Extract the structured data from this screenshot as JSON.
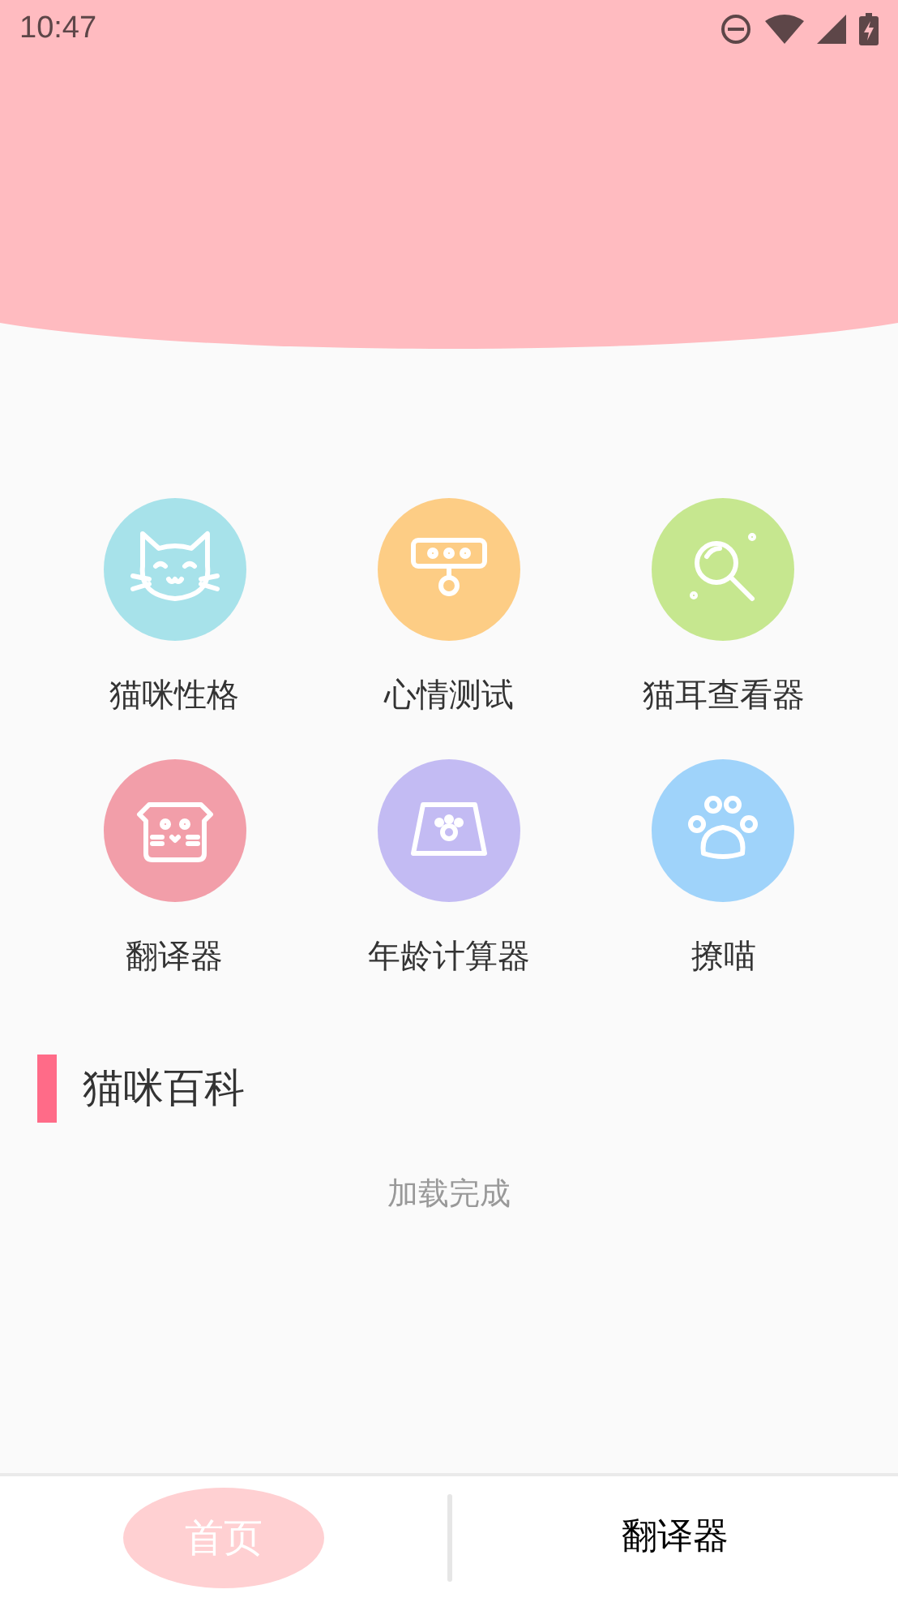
{
  "status_bar": {
    "time": "10:47"
  },
  "features": [
    {
      "label": "猫咪性格",
      "kind": "cat",
      "color": "#a7e2ea"
    },
    {
      "label": "心情测试",
      "kind": "collar",
      "color": "#fdcd85"
    },
    {
      "label": "猫耳查看器",
      "kind": "magnifier",
      "color": "#c6e78f"
    },
    {
      "label": "翻译器",
      "kind": "catbox",
      "color": "#f29ea9"
    },
    {
      "label": "年龄计算器",
      "kind": "bowl",
      "color": "#c3bbf3"
    },
    {
      "label": "撩喵",
      "kind": "paw",
      "color": "#9fd3fa"
    }
  ],
  "section": {
    "title": "猫咪百科",
    "status": "加载完成"
  },
  "tabs": [
    {
      "label": "首页",
      "selected": true
    },
    {
      "label": "翻译器",
      "selected": false
    }
  ]
}
